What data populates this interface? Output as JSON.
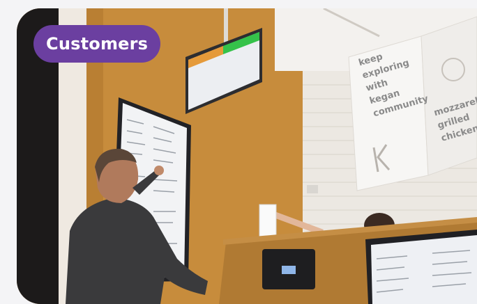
{
  "badge": {
    "label": "Customers",
    "color": "#6b3fa0"
  },
  "scene": {
    "wall_sign_left": "keep\nexploring\nwith\nkegan\ncommunity",
    "wall_sign_right": "mozzarella\ngrilled\nchicken"
  },
  "colors": {
    "wall": "#c9913f",
    "brick": "#ece8e2",
    "screen_header_green": "#35c24a",
    "counter": "#b07a33"
  }
}
